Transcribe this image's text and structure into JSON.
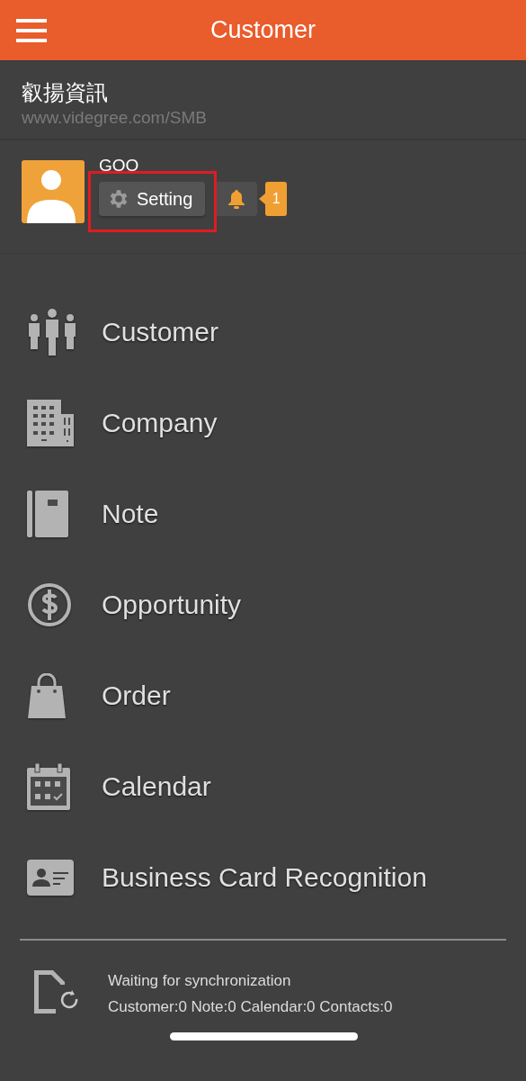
{
  "header": {
    "title": "Customer"
  },
  "company": {
    "name": "叡揚資訊",
    "url": "www.videgree.com/SMB"
  },
  "user": {
    "name": "GOO",
    "setting": {
      "label": "Setting",
      "highlighted": true
    },
    "notifications": "1"
  },
  "menu": [
    {
      "kind": "people",
      "label": "Customer"
    },
    {
      "kind": "building",
      "label": "Company"
    },
    {
      "kind": "notebook",
      "label": "Note"
    },
    {
      "kind": "dollar",
      "label": "Opportunity"
    },
    {
      "kind": "bag",
      "label": "Order"
    },
    {
      "kind": "calendar",
      "label": "Calendar"
    },
    {
      "kind": "card",
      "label": "Business Card Recognition"
    }
  ],
  "sync": {
    "status": "Waiting for synchronization",
    "counts": "Customer:0 Note:0 Calendar:0 Contacts:0"
  }
}
